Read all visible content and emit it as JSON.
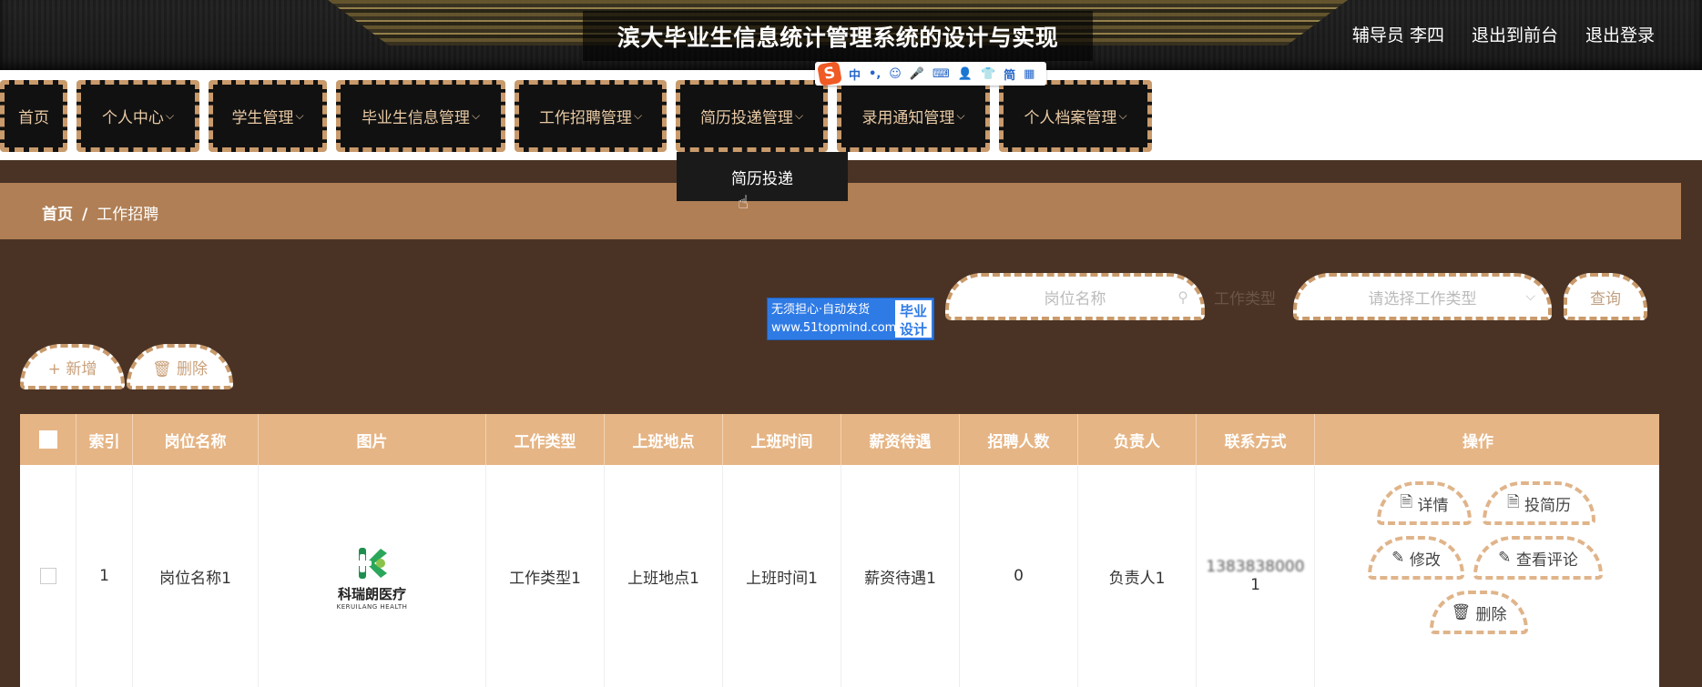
{
  "header": {
    "title": "滨大毕业生信息统计管理系统的设计与实现",
    "user_label": "辅导员 李四",
    "front_label": "退出到前台",
    "logout_label": "退出登录"
  },
  "ime": {
    "logo": "S",
    "items": [
      "中",
      "•,",
      "☺",
      "🎤",
      "⌨",
      "👤",
      "👕",
      "简",
      "▦"
    ]
  },
  "nav": {
    "items": [
      {
        "label": "首页",
        "chevron": ""
      },
      {
        "label": "个人中心",
        "chevron": "⌵"
      },
      {
        "label": "学生管理",
        "chevron": "⌵"
      },
      {
        "label": "毕业生信息管理",
        "chevron": "⌵"
      },
      {
        "label": "工作招聘管理",
        "chevron": "⌵"
      },
      {
        "label": "简历投递管理",
        "chevron": "⌵"
      },
      {
        "label": "录用通知管理",
        "chevron": "⌵"
      },
      {
        "label": "个人档案管理",
        "chevron": "⌵"
      }
    ],
    "dropdown_item": "简历投递"
  },
  "breadcrumb": {
    "home": "首页",
    "sep": "/",
    "current": "工作招聘"
  },
  "ad": {
    "line1": "无须担心·自动发货",
    "line2": "www.51topmind.com",
    "right1": "毕业",
    "right2": "设计"
  },
  "search": {
    "name_placeholder": "岗位名称",
    "type_label": "工作类型",
    "type_placeholder": "请选择工作类型",
    "query_label": "查询"
  },
  "actions": {
    "add_label": "+ 新增",
    "delete_label": "🗑 删除"
  },
  "table": {
    "headers": [
      "",
      "索引",
      "岗位名称",
      "图片",
      "工作类型",
      "上班地点",
      "上班时间",
      "薪资待遇",
      "招聘人数",
      "负责人",
      "联系方式",
      "操作"
    ],
    "rows": [
      {
        "index": "1",
        "position": "岗位名称1",
        "logo_cn": "科瑞朗医疗",
        "logo_en": "KERUILANG HEALTH",
        "type": "工作类型1",
        "location": "上班地点1",
        "time": "上班时间1",
        "salary": "薪资待遇1",
        "headcount": "0",
        "manager": "负责人1",
        "contact_line1": "1383838000",
        "contact_line2": "1",
        "ops": {
          "detail": "详情",
          "resume": "投简历",
          "edit": "修改",
          "reviews": "查看评论",
          "delete": "删除"
        }
      }
    ]
  }
}
